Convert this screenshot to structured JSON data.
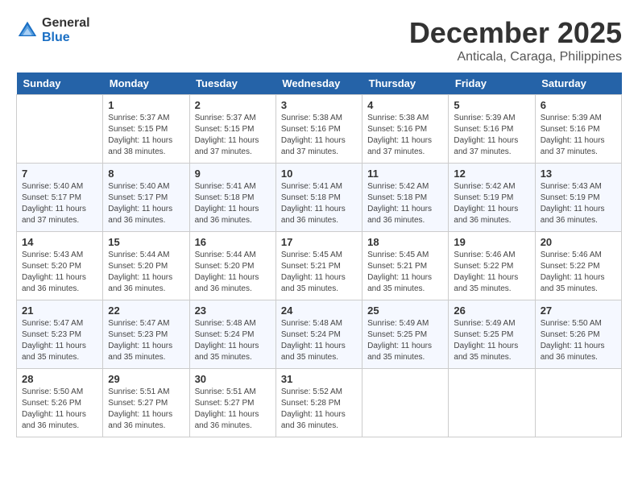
{
  "header": {
    "logo_general": "General",
    "logo_blue": "Blue",
    "month_title": "December 2025",
    "location": "Anticala, Caraga, Philippines"
  },
  "weekdays": [
    "Sunday",
    "Monday",
    "Tuesday",
    "Wednesday",
    "Thursday",
    "Friday",
    "Saturday"
  ],
  "weeks": [
    [
      {
        "day": "",
        "sunrise": "",
        "sunset": "",
        "daylight": ""
      },
      {
        "day": "1",
        "sunrise": "5:37 AM",
        "sunset": "5:15 PM",
        "daylight": "11 hours and 38 minutes."
      },
      {
        "day": "2",
        "sunrise": "5:37 AM",
        "sunset": "5:15 PM",
        "daylight": "11 hours and 37 minutes."
      },
      {
        "day": "3",
        "sunrise": "5:38 AM",
        "sunset": "5:16 PM",
        "daylight": "11 hours and 37 minutes."
      },
      {
        "day": "4",
        "sunrise": "5:38 AM",
        "sunset": "5:16 PM",
        "daylight": "11 hours and 37 minutes."
      },
      {
        "day": "5",
        "sunrise": "5:39 AM",
        "sunset": "5:16 PM",
        "daylight": "11 hours and 37 minutes."
      },
      {
        "day": "6",
        "sunrise": "5:39 AM",
        "sunset": "5:16 PM",
        "daylight": "11 hours and 37 minutes."
      }
    ],
    [
      {
        "day": "7",
        "sunrise": "5:40 AM",
        "sunset": "5:17 PM",
        "daylight": "11 hours and 37 minutes."
      },
      {
        "day": "8",
        "sunrise": "5:40 AM",
        "sunset": "5:17 PM",
        "daylight": "11 hours and 36 minutes."
      },
      {
        "day": "9",
        "sunrise": "5:41 AM",
        "sunset": "5:18 PM",
        "daylight": "11 hours and 36 minutes."
      },
      {
        "day": "10",
        "sunrise": "5:41 AM",
        "sunset": "5:18 PM",
        "daylight": "11 hours and 36 minutes."
      },
      {
        "day": "11",
        "sunrise": "5:42 AM",
        "sunset": "5:18 PM",
        "daylight": "11 hours and 36 minutes."
      },
      {
        "day": "12",
        "sunrise": "5:42 AM",
        "sunset": "5:19 PM",
        "daylight": "11 hours and 36 minutes."
      },
      {
        "day": "13",
        "sunrise": "5:43 AM",
        "sunset": "5:19 PM",
        "daylight": "11 hours and 36 minutes."
      }
    ],
    [
      {
        "day": "14",
        "sunrise": "5:43 AM",
        "sunset": "5:20 PM",
        "daylight": "11 hours and 36 minutes."
      },
      {
        "day": "15",
        "sunrise": "5:44 AM",
        "sunset": "5:20 PM",
        "daylight": "11 hours and 36 minutes."
      },
      {
        "day": "16",
        "sunrise": "5:44 AM",
        "sunset": "5:20 PM",
        "daylight": "11 hours and 36 minutes."
      },
      {
        "day": "17",
        "sunrise": "5:45 AM",
        "sunset": "5:21 PM",
        "daylight": "11 hours and 35 minutes."
      },
      {
        "day": "18",
        "sunrise": "5:45 AM",
        "sunset": "5:21 PM",
        "daylight": "11 hours and 35 minutes."
      },
      {
        "day": "19",
        "sunrise": "5:46 AM",
        "sunset": "5:22 PM",
        "daylight": "11 hours and 35 minutes."
      },
      {
        "day": "20",
        "sunrise": "5:46 AM",
        "sunset": "5:22 PM",
        "daylight": "11 hours and 35 minutes."
      }
    ],
    [
      {
        "day": "21",
        "sunrise": "5:47 AM",
        "sunset": "5:23 PM",
        "daylight": "11 hours and 35 minutes."
      },
      {
        "day": "22",
        "sunrise": "5:47 AM",
        "sunset": "5:23 PM",
        "daylight": "11 hours and 35 minutes."
      },
      {
        "day": "23",
        "sunrise": "5:48 AM",
        "sunset": "5:24 PM",
        "daylight": "11 hours and 35 minutes."
      },
      {
        "day": "24",
        "sunrise": "5:48 AM",
        "sunset": "5:24 PM",
        "daylight": "11 hours and 35 minutes."
      },
      {
        "day": "25",
        "sunrise": "5:49 AM",
        "sunset": "5:25 PM",
        "daylight": "11 hours and 35 minutes."
      },
      {
        "day": "26",
        "sunrise": "5:49 AM",
        "sunset": "5:25 PM",
        "daylight": "11 hours and 35 minutes."
      },
      {
        "day": "27",
        "sunrise": "5:50 AM",
        "sunset": "5:26 PM",
        "daylight": "11 hours and 36 minutes."
      }
    ],
    [
      {
        "day": "28",
        "sunrise": "5:50 AM",
        "sunset": "5:26 PM",
        "daylight": "11 hours and 36 minutes."
      },
      {
        "day": "29",
        "sunrise": "5:51 AM",
        "sunset": "5:27 PM",
        "daylight": "11 hours and 36 minutes."
      },
      {
        "day": "30",
        "sunrise": "5:51 AM",
        "sunset": "5:27 PM",
        "daylight": "11 hours and 36 minutes."
      },
      {
        "day": "31",
        "sunrise": "5:52 AM",
        "sunset": "5:28 PM",
        "daylight": "11 hours and 36 minutes."
      },
      {
        "day": "",
        "sunrise": "",
        "sunset": "",
        "daylight": ""
      },
      {
        "day": "",
        "sunrise": "",
        "sunset": "",
        "daylight": ""
      },
      {
        "day": "",
        "sunrise": "",
        "sunset": "",
        "daylight": ""
      }
    ]
  ]
}
